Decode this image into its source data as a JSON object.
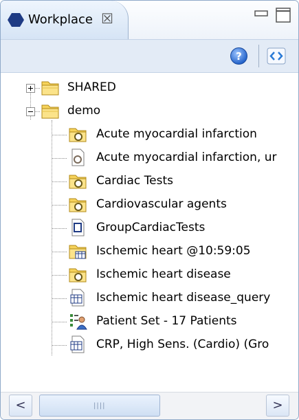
{
  "view": {
    "title": "Workplace",
    "close_glyph": "☒",
    "icons": {
      "tab": "workplace-hexagon-icon",
      "minimize": "minimize-icon",
      "maximize": "maximize-icon",
      "help": "help-icon",
      "link": "link-editor-icon"
    }
  },
  "tree": {
    "roots": [
      {
        "label": "SHARED",
        "expanded": false,
        "icon": "folder-icon"
      },
      {
        "label": "demo",
        "expanded": true,
        "icon": "folder-icon"
      }
    ],
    "children": [
      {
        "label": "Acute myocardial infarction",
        "icon": "folder-search-icon"
      },
      {
        "label": "Acute myocardial infarction, ur",
        "icon": "document-search-icon"
      },
      {
        "label": "Cardiac Tests",
        "icon": "folder-search-icon"
      },
      {
        "label": "Cardiovascular agents",
        "icon": "folder-search-icon"
      },
      {
        "label": "GroupCardiacTests",
        "icon": "document-icon"
      },
      {
        "label": "Ischemic heart @10:59:05",
        "icon": "folder-table-icon"
      },
      {
        "label": "Ischemic heart disease",
        "icon": "folder-search-icon"
      },
      {
        "label": "Ischemic heart disease_query",
        "icon": "document-table-icon"
      },
      {
        "label": "Patient Set - 17 Patients",
        "icon": "patient-set-icon"
      },
      {
        "label": "CRP, High Sens. (Cardio) (Gro",
        "icon": "document-table-icon"
      }
    ]
  },
  "scrollbar": {
    "left_arrow": "<",
    "right_arrow": ">",
    "grip": "||||"
  },
  "colors": {
    "frame_border": "#8fa9c9",
    "toolbar_bg": "#e3ebf6",
    "folder_yellow": "#f6d25a",
    "hexagon": "#1f3b84"
  }
}
